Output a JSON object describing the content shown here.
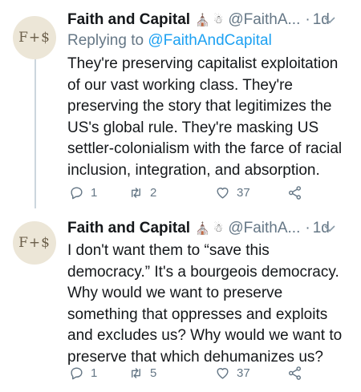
{
  "tweets": [
    {
      "avatar_text": "F+$",
      "name": "Faith and Capital",
      "emoji_1": "⛪",
      "emoji_2": "☃",
      "handle": "@FaithA...",
      "dot": "·",
      "time": "1d",
      "replying_prefix": "Replying to ",
      "replying_to": "@FaithAndCapital",
      "text": "They're preserving capitalist exploitation of our vast working class. They're preserving the story that legitimizes the US's global rule. They're masking US settler-colonialism with the farce of racial inclusion, integration, and absorption.",
      "replies": "1",
      "retweets": "2",
      "likes": "37"
    },
    {
      "avatar_text": "F+$",
      "name": "Faith and Capital",
      "emoji_1": "⛪",
      "emoji_2": "☃",
      "handle": "@FaithA...",
      "dot": "·",
      "time": "1d",
      "text": "I don't want them to “save this democracy.” It's a bourgeois democracy. Why would we want to preserve something that oppresses and exploits and excludes us? Why would we want to preserve that which dehumanizes us?",
      "replies": "1",
      "retweets": "5",
      "likes": "37"
    }
  ],
  "icons": {
    "reply": "reply-icon",
    "retweet": "retweet-icon",
    "like": "heart-icon",
    "share": "share-icon",
    "menu": "chevron-down-icon"
  },
  "colors": {
    "link": "#1da1f2",
    "muted": "#657786",
    "text": "#14171a"
  }
}
